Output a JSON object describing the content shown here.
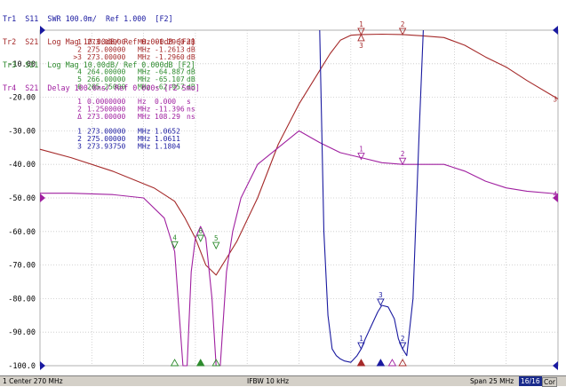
{
  "chart_data": {
    "type": "line",
    "title": "",
    "xlabel": "",
    "ylabel": "",
    "center_mhz": 270,
    "span_mhz": 25,
    "xlim": [
      257.5,
      282.5
    ],
    "ylim": [
      -100,
      0
    ],
    "grid": true,
    "y_tick_labels": [
      "",
      "-10.00",
      "-20.00",
      "-30.00",
      "-40.00",
      "-50.00",
      "-60.00",
      "-70.00",
      "-80.00",
      "-90.00",
      "-100.0"
    ],
    "series": [
      {
        "name": "Tr2 S21 Log Mag",
        "color": "#a52a2a",
        "x": [
          257.5,
          259,
          261,
          263,
          264,
          264.5,
          265,
          265.5,
          266,
          266.5,
          267,
          268,
          269,
          270,
          271,
          271.5,
          272,
          272.5,
          273,
          274,
          275,
          276,
          277,
          278,
          279,
          280,
          281,
          282.5
        ],
        "y": [
          -35.5,
          -38,
          -42,
          -47,
          -51,
          -56,
          -62,
          -70,
          -73,
          -68,
          -63,
          -50,
          -34,
          -22,
          -12,
          -7,
          -3,
          -1.5,
          -1.3,
          -1.2,
          -1.3,
          -1.7,
          -2.2,
          -4.5,
          -8,
          -11,
          -15,
          -20.5
        ]
      },
      {
        "name": "Tr3 S21 Log Mag",
        "color": "#2e8b2e",
        "x": [
          264,
          266,
          265.25
        ],
        "y": [
          -64.887,
          -65.107,
          -62.957
        ]
      },
      {
        "name": "Tr4 S21 Delay",
        "color": "#a020a0",
        "x": [
          257.5,
          259,
          261,
          262.5,
          263.5,
          264,
          264.4,
          264.6,
          264.8,
          265,
          265.25,
          265.5,
          265.8,
          266,
          266.2,
          266.5,
          266.8,
          267.2,
          268,
          269,
          270,
          271,
          272,
          273,
          274,
          275,
          276,
          277,
          278,
          279,
          280,
          281,
          282.5
        ],
        "y": [
          -48.6,
          -48.6,
          -49,
          -50,
          -56,
          -66,
          -100,
          -100,
          -72,
          -62,
          -58.5,
          -62,
          -80,
          -100,
          -100,
          -72,
          -60,
          -50,
          -40,
          -35,
          -30,
          -33.5,
          -36.5,
          -38,
          -39.5,
          -40,
          -40,
          -40,
          -42,
          -45,
          -47,
          -48,
          -48.8
        ]
      },
      {
        "name": "Tr1 S11 SWR",
        "color": "#1a1aa0",
        "x": [
          271,
          271.2,
          271.4,
          271.6,
          271.8,
          272,
          272.2,
          272.5,
          272.8,
          273,
          273.2,
          273.5,
          273.8,
          274,
          274.3,
          274.6,
          274.8,
          275,
          275.2,
          275.5,
          275.8,
          276
        ],
        "y": [
          0,
          -60,
          -85,
          -95,
          -97,
          -98,
          -98.6,
          -99,
          -97,
          -95,
          -92,
          -88,
          -84,
          -82,
          -82.5,
          -86,
          -92,
          -95,
          -97,
          -80,
          -30,
          0
        ]
      }
    ]
  },
  "header": {
    "lines": [
      {
        "text": "Tr1  S11  SWR 100.0m/  Ref 1.000  [F2]",
        "color": "#1a1aa0"
      },
      {
        "text": "Tr2  S21  Log Mag 10.00dB/ Ref 0.000dB [F2]",
        "color": "#a52a2a"
      },
      {
        "text": "Tr3  S21  Log Mag 10.00dB/ Ref 0.000dB [F2]",
        "color": "#2e8b2e"
      },
      {
        "text": "Tr4  S21  Delay 100.0ns/ Ref 0.000s [F2 Smo]",
        "color": "#a020a0"
      }
    ]
  },
  "marker_tables": [
    {
      "color": "#a52a2a",
      "rows": [
        {
          "id": "1",
          "freq": "273.00000",
          "unit": "MHz",
          "value": "-1.2960",
          "vunit": "dB"
        },
        {
          "id": "2",
          "freq": "275.00000",
          "unit": "MHz",
          "value": "-1.2613",
          "vunit": "dB"
        },
        {
          "id": ">3",
          "freq": "273.00000",
          "unit": "MHz",
          "value": "-1.2960",
          "vunit": "dB"
        }
      ]
    },
    {
      "color": "#2e8b2e",
      "rows": [
        {
          "id": "4",
          "freq": "264.00000",
          "unit": "MHz",
          "value": "-64.887",
          "vunit": "dB"
        },
        {
          "id": "5",
          "freq": "266.00000",
          "unit": "MHz",
          "value": "-65.107",
          "vunit": "dB"
        },
        {
          "id": "6",
          "freq": "265.25000",
          "unit": "MHz",
          "value": "-62.957",
          "vunit": "dB"
        }
      ]
    },
    {
      "color": "#a020a0",
      "rows": [
        {
          "id": "1",
          "freq": "0.0000000",
          "unit": "Hz",
          "value": "0.000",
          "vunit": "s"
        },
        {
          "id": "2",
          "freq": "1.2500000",
          "unit": "MHz",
          "value": "-11.396",
          "vunit": "ns"
        },
        {
          "id": "Δ",
          "freq": "273.00000",
          "unit": "MHz",
          "value": "108.29",
          "vunit": "ns"
        }
      ]
    },
    {
      "color": "#1a1aa0",
      "rows": [
        {
          "id": "1",
          "freq": "273.00000",
          "unit": "MHz",
          "value": "1.0652",
          "vunit": ""
        },
        {
          "id": "2",
          "freq": "275.00000",
          "unit": "MHz",
          "value": "1.0611",
          "vunit": ""
        },
        {
          "id": "3",
          "freq": "273.93750",
          "unit": "MHz",
          "value": "1.1804",
          "vunit": ""
        }
      ]
    }
  ],
  "trace_markers": [
    {
      "label": "1",
      "color": "#a52a2a",
      "x": 273.0,
      "y": -1.3,
      "dir": "down"
    },
    {
      "label": "2",
      "color": "#a52a2a",
      "x": 275.0,
      "y": -1.3,
      "dir": "down"
    },
    {
      "label": "3",
      "color": "#a52a2a",
      "x": 273.0,
      "y": -1.3,
      "dir": "up"
    },
    {
      "label": "4",
      "color": "#2e8b2e",
      "x": 264.0,
      "y": -64.9,
      "dir": "down"
    },
    {
      "label": "5",
      "color": "#2e8b2e",
      "x": 266.0,
      "y": -65.1,
      "dir": "down"
    },
    {
      "label": "6",
      "color": "#2e8b2e",
      "x": 265.25,
      "y": -62.96,
      "dir": "down"
    },
    {
      "label": "1",
      "color": "#a020a0",
      "x": 273.0,
      "y": -38.5,
      "dir": "down"
    },
    {
      "label": "2",
      "color": "#a020a0",
      "x": 275.0,
      "y": -40.0,
      "dir": "down"
    },
    {
      "label": "1",
      "color": "#1a1aa0",
      "x": 273.0,
      "y": -95.0,
      "dir": "down"
    },
    {
      "label": "2",
      "color": "#1a1aa0",
      "x": 275.0,
      "y": -95.0,
      "dir": "down"
    },
    {
      "label": "3",
      "color": "#1a1aa0",
      "x": 273.94,
      "y": -82.0,
      "dir": "down"
    }
  ],
  "right_labels": [
    {
      "label": "3",
      "color": "#a52a2a",
      "y": -20.5
    },
    {
      "label": "4",
      "color": "#a020a0",
      "y": -48.8
    }
  ],
  "status": {
    "left": "1  Center 270 MHz",
    "mid": "IFBW 10 kHz",
    "span": "Span 25 MHz",
    "count": "16/16",
    "cor": "Cor"
  }
}
